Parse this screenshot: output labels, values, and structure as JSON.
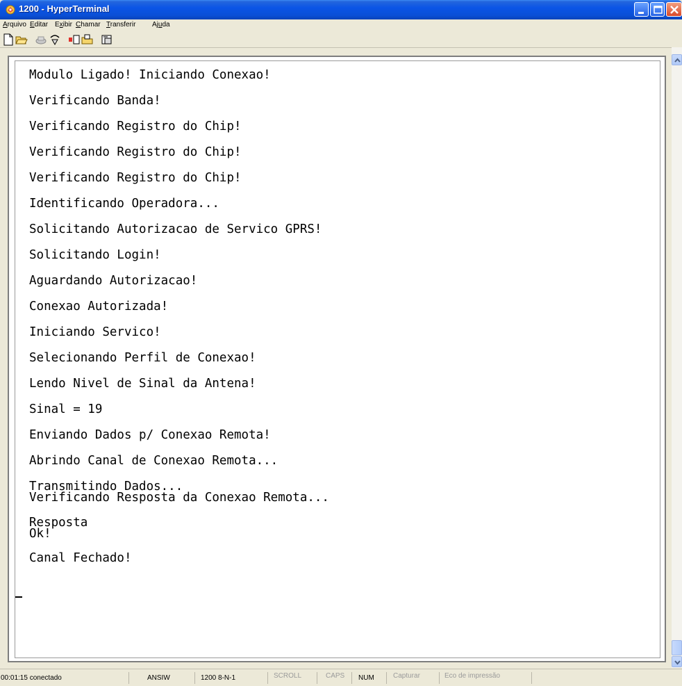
{
  "window": {
    "title": "1200 - HyperTerminal"
  },
  "menu": [
    {
      "label": "Arquivo",
      "shortcut": "A"
    },
    {
      "label": "Editar",
      "shortcut": "E"
    },
    {
      "label": "Exibir",
      "shortcut": "x"
    },
    {
      "label": "Chamar",
      "shortcut": "C"
    },
    {
      "label": "Transferir",
      "shortcut": "T"
    },
    {
      "label": "Ajuda",
      "shortcut": "u"
    }
  ],
  "toolbar": [
    {
      "icon": "new-document-icon"
    },
    {
      "icon": "open-folder-icon"
    },
    {
      "icon": "call-icon"
    },
    {
      "icon": "disconnect-icon"
    },
    {
      "icon": "send-icon"
    },
    {
      "icon": "receive-icon"
    },
    {
      "icon": "properties-icon"
    }
  ],
  "terminal": {
    "lines": [
      "Modulo Ligado! Iniciando Conexao!",
      "Verificando Banda!",
      "Verificando Registro do Chip!",
      "Verificando Registro do Chip!",
      "Verificando Registro do Chip!",
      "Identificando Operadora...",
      "Solicitando Autorizacao de Servico GPRS!",
      "Solicitando Login!",
      "Aguardando Autorizacao!",
      "Conexao Autorizada!",
      "Iniciando Servico!",
      "Selecionando Perfil de Conexao!",
      "Lendo Nivel de Sinal da Antena!",
      "Sinal = 19",
      "Enviando Dados p/ Conexao Remota!",
      "Abrindo Canal de Conexao Remota...",
      "Transmitindo Dados...",
      "Verificando Resposta da Conexao Remota...",
      "Resposta",
      "Ok!",
      "Canal Fechado!"
    ]
  },
  "status": {
    "connection": "00:01:15 conectado",
    "emulation": "ANSIW",
    "settings": "1200 8-N-1",
    "scroll": "SCROLL",
    "caps": "CAPS",
    "num": "NUM",
    "capture": "Capturar",
    "echo": "Eco de impressão"
  }
}
